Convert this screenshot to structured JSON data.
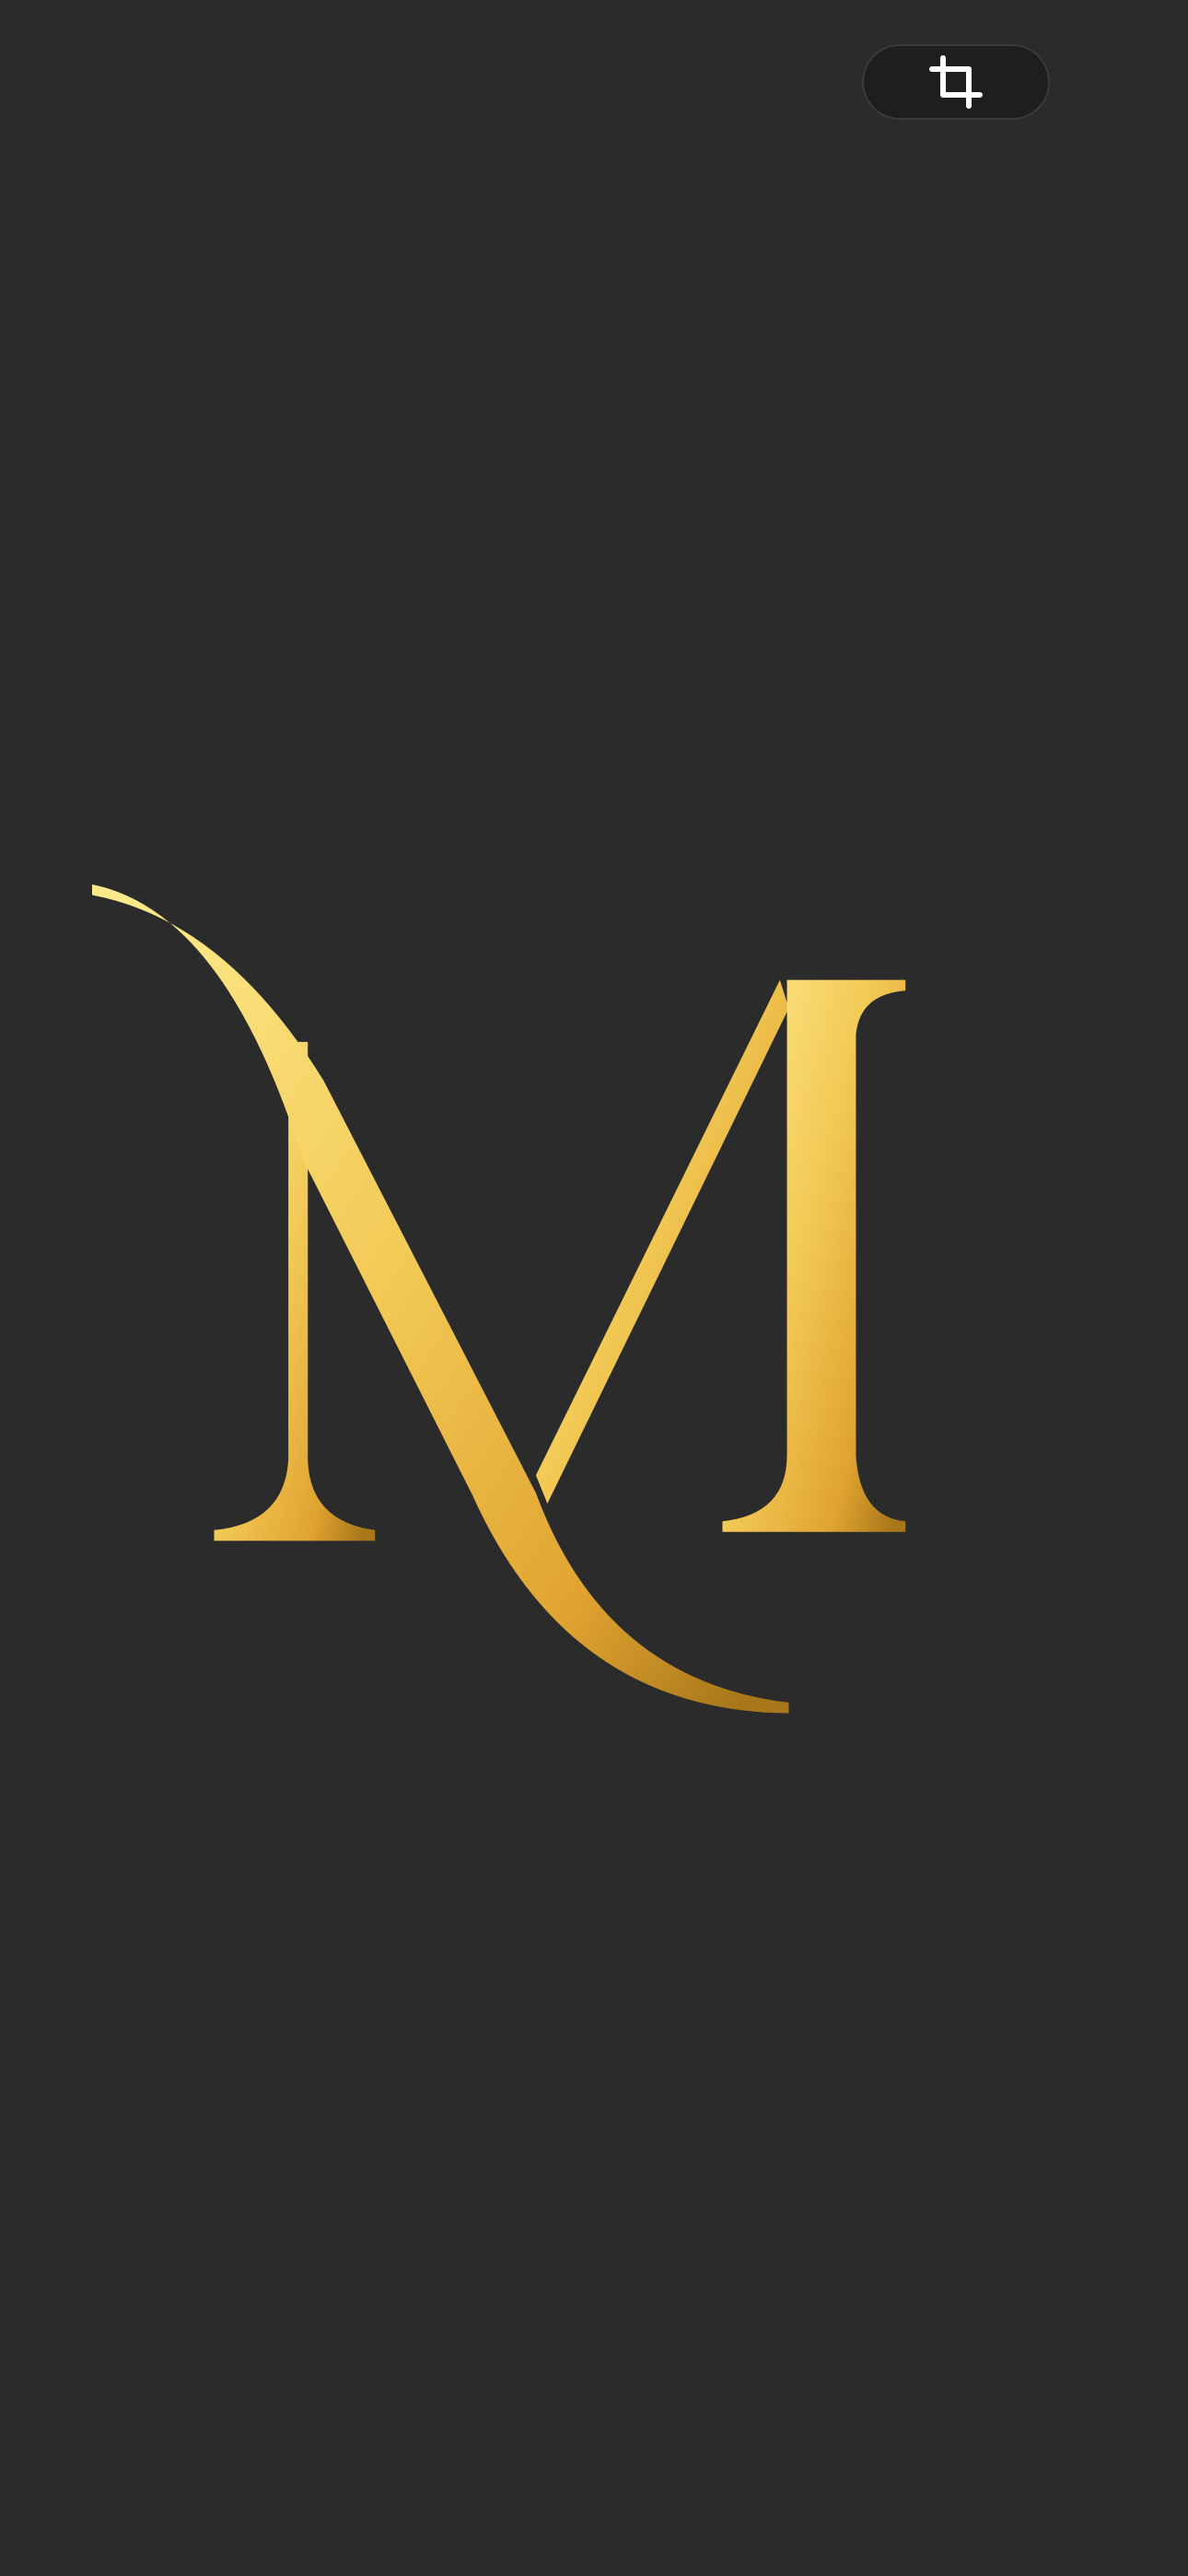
{
  "theme": {
    "background": "#2b2b2b",
    "pill_background": "#1e1e1e",
    "icon_color": "#ffffff"
  },
  "toolbar": {
    "crop_icon": "crop-icon"
  },
  "logo": {
    "icon": "monogram-m-icon",
    "gradient": {
      "light": "#fde98a",
      "mid": "#f2c955",
      "deep": "#e0a330",
      "dark": "#a8771a"
    }
  }
}
